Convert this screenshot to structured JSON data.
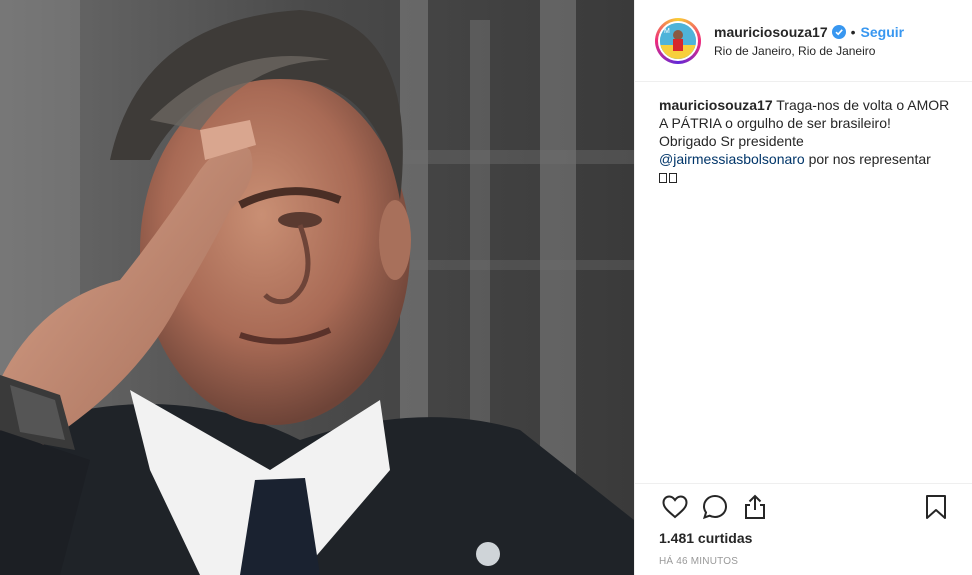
{
  "header": {
    "username": "mauriciosouza17",
    "separator": "•",
    "follow_label": "Seguir",
    "location": "Rio de Janeiro, Rio de Janeiro"
  },
  "caption": {
    "username": "mauriciosouza17",
    "line1": " Traga-nos de volta o AMOR A PÁTRIA o orgulho de ser brasileiro!",
    "line2": "Obrigado Sr presidente",
    "mention": "@jairmessiasbolsonaro",
    "line3": " por nos representar"
  },
  "actions": {
    "icons": [
      "heart-icon",
      "comment-icon",
      "share-icon",
      "bookmark-icon"
    ]
  },
  "stats": {
    "likes": "1.481 curtidas",
    "time": "HÁ 46 MINUTOS"
  },
  "colors": {
    "link": "#3897f0",
    "mention": "#003569",
    "verified": "#3897f0",
    "muted": "#999999"
  }
}
